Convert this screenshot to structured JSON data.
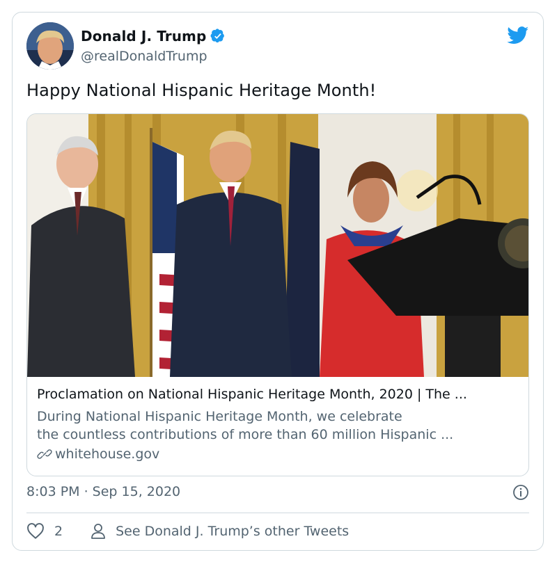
{
  "tweet": {
    "author_name": "Donald J. Trump",
    "author_handle": "@realDonaldTrump",
    "text": "Happy National Hispanic Heritage Month!",
    "timestamp": "8:03 PM · Sep 15, 2020",
    "like_count": "2",
    "see_other_label": "See Donald J. Trump’s other Tweets"
  },
  "link_card": {
    "title": "Proclamation on National Hispanic Heritage Month, 2020 | The ...",
    "description_line1": "During National Hispanic Heritage Month, we celebrate",
    "description_line2": "the countless contributions of more than 60 million Hispanic ...",
    "domain": "whitehouse.gov"
  },
  "icons": {
    "verified": "verified-badge-icon",
    "brand": "twitter-bird-icon",
    "link": "link-icon",
    "info": "info-icon",
    "like": "heart-icon",
    "profile": "person-icon"
  },
  "colors": {
    "brand_blue": "#1d9bf0",
    "secondary_text": "#536471",
    "border": "#cfd9de"
  }
}
